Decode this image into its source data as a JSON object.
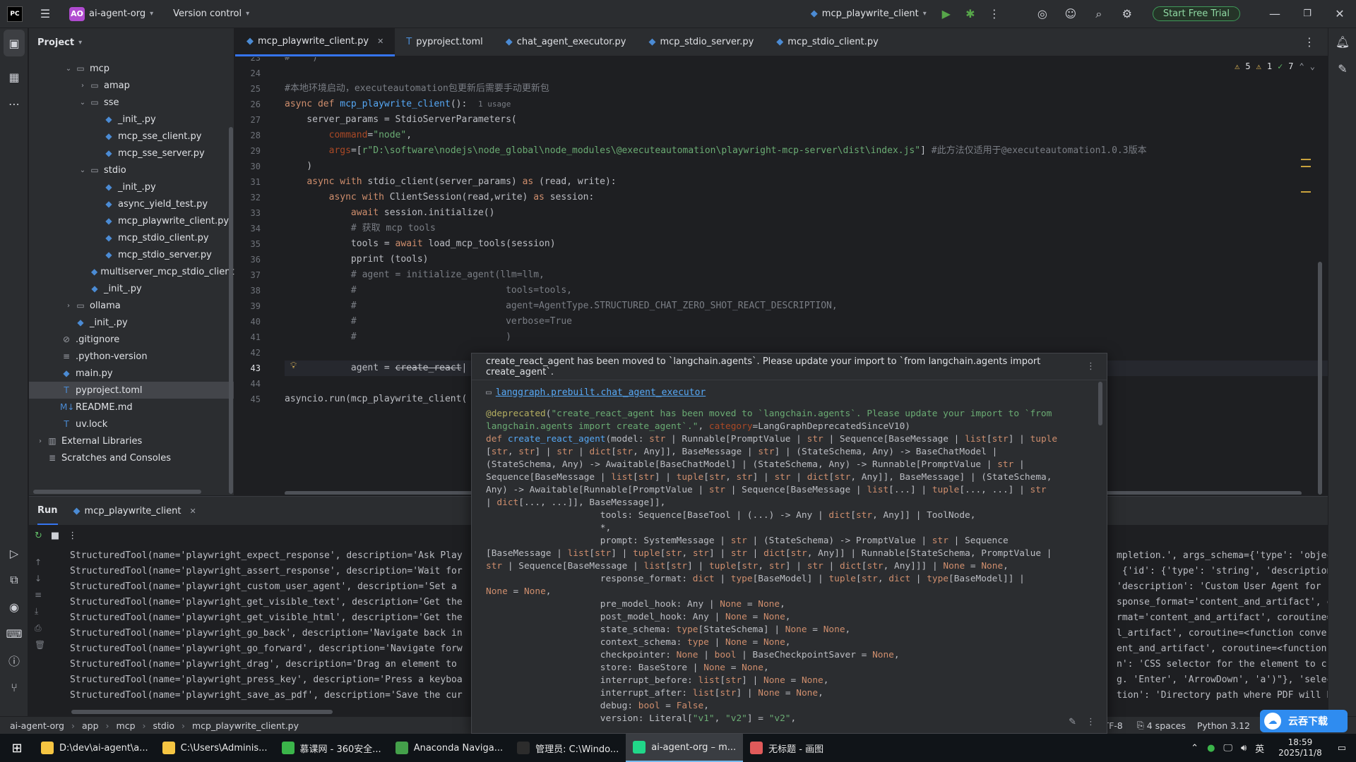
{
  "titlebar": {
    "project_badge": "AO",
    "project_name": "ai-agent-org",
    "vcs": "Version control",
    "run_config": "mcp_playwrite_client",
    "trial_button": "Start Free Trial",
    "icons": [
      "hamburger-icon",
      "run-icon",
      "debug-icon",
      "more-icon",
      "copilot-icon",
      "add-user-icon",
      "search-icon",
      "settings-icon",
      "minimize-icon",
      "restore-icon",
      "close-icon"
    ]
  },
  "project_panel": {
    "title": "Project",
    "rows": [
      {
        "label": "mcp",
        "depth": 2,
        "type": "folder",
        "open": true
      },
      {
        "label": "amap",
        "depth": 3,
        "type": "folder",
        "open": false
      },
      {
        "label": "sse",
        "depth": 3,
        "type": "folder",
        "open": true
      },
      {
        "label": "_init_.py",
        "depth": 4,
        "type": "py"
      },
      {
        "label": "mcp_sse_client.py",
        "depth": 4,
        "type": "py"
      },
      {
        "label": "mcp_sse_server.py",
        "depth": 4,
        "type": "py"
      },
      {
        "label": "stdio",
        "depth": 3,
        "type": "folder",
        "open": true
      },
      {
        "label": "_init_.py",
        "depth": 4,
        "type": "py"
      },
      {
        "label": "async_yield_test.py",
        "depth": 4,
        "type": "py"
      },
      {
        "label": "mcp_playwrite_client.py",
        "depth": 4,
        "type": "py"
      },
      {
        "label": "mcp_stdio_client.py",
        "depth": 4,
        "type": "py"
      },
      {
        "label": "mcp_stdio_server.py",
        "depth": 4,
        "type": "py"
      },
      {
        "label": "multiserver_mcp_stdio_client.",
        "depth": 4,
        "type": "py"
      },
      {
        "label": "_init_.py",
        "depth": 3,
        "type": "py"
      },
      {
        "label": "ollama",
        "depth": 2,
        "type": "folder",
        "open": false
      },
      {
        "label": "_init_.py",
        "depth": 2,
        "type": "py"
      },
      {
        "label": ".gitignore",
        "depth": 1,
        "type": "ignore"
      },
      {
        "label": ".python-version",
        "depth": 1,
        "type": "text"
      },
      {
        "label": "main.py",
        "depth": 1,
        "type": "py"
      },
      {
        "label": "pyproject.toml",
        "depth": 1,
        "type": "toml",
        "selected": true
      },
      {
        "label": "README.md",
        "depth": 1,
        "type": "md"
      },
      {
        "label": "uv.lock",
        "depth": 1,
        "type": "toml"
      },
      {
        "label": "External Libraries",
        "depth": 0,
        "type": "lib",
        "open": false
      },
      {
        "label": "Scratches and Consoles",
        "depth": 0,
        "type": "scratch"
      }
    ]
  },
  "tabs": [
    {
      "label": "mcp_playwrite_client.py",
      "active": true,
      "closable": true
    },
    {
      "label": "pyproject.toml"
    },
    {
      "label": "chat_agent_executor.py"
    },
    {
      "label": "mcp_stdio_server.py"
    },
    {
      "label": "mcp_stdio_client.py"
    }
  ],
  "inspections": {
    "warn_a": "5",
    "warn_b": "1",
    "ok": "7"
  },
  "editor": {
    "current_line": 43,
    "lines": [
      {
        "n": "23",
        "html": "<span class=\"cm\">#    )</span>"
      },
      {
        "n": "24",
        "html": ""
      },
      {
        "n": "25",
        "html": "<span class=\"cm\">#本地环境启动，executeautomation包更新后需要手动更新包</span>"
      },
      {
        "n": "26",
        "html": "<span class=\"kw\">async def </span><span class=\"fn\">mcp_playwrite_client</span>():  <span class=\"cm\" style=\"font-size:11px\">1 usage</span>"
      },
      {
        "n": "27",
        "html": "    server_params = StdioServerParameters("
      },
      {
        "n": "28",
        "html": "        <span class=\"par\">command</span>=<span class=\"str\">\"node\"</span>,"
      },
      {
        "n": "29",
        "html": "        <span class=\"par\">args</span>=[<span class=\"str\">r\"D:\\software\\nodejs\\node_global\\node_modules\\@executeautomation\\playwright-mcp-server\\dist\\index.js\"</span>] <span class=\"cm\">#此方法仅适用于@executeautomation1.0.3版本</span>"
      },
      {
        "n": "30",
        "html": "    )"
      },
      {
        "n": "31",
        "html": "    <span class=\"kw\">async with </span>stdio_client(server_params) <span class=\"kw\">as </span>(read, write):"
      },
      {
        "n": "32",
        "html": "        <span class=\"kw\">async with </span>ClientSession(read,write) <span class=\"kw\">as </span>session:"
      },
      {
        "n": "33",
        "html": "            <span class=\"kw\">await </span>session.initialize()"
      },
      {
        "n": "34",
        "html": "            <span class=\"cm\"># 获取 mcp tools</span>"
      },
      {
        "n": "35",
        "html": "            tools = <span class=\"kw\">await </span>load_mcp_tools(session)"
      },
      {
        "n": "36",
        "html": "            pprint (tools)"
      },
      {
        "n": "37",
        "html": "            <span class=\"cm\"># agent = initialize_agent(llm=llm,</span>"
      },
      {
        "n": "38",
        "html": "            <span class=\"cm\">#                           tools=tools,</span>"
      },
      {
        "n": "39",
        "html": "            <span class=\"cm\">#                           agent=AgentType.STRUCTURED_CHAT_ZERO_SHOT_REACT_DESCRIPTION,</span>"
      },
      {
        "n": "40",
        "html": "            <span class=\"cm\">#                           verbose=True</span>"
      },
      {
        "n": "41",
        "html": "            <span class=\"cm\">#                           )</span>"
      },
      {
        "n": "42",
        "html": ""
      },
      {
        "n": "43",
        "html": "            agent = <span class=\"dep\">create_react</span>|"
      },
      {
        "n": "44",
        "html": ""
      },
      {
        "n": "45",
        "html": "asyncio.run(mcp_playwrite_client("
      }
    ]
  },
  "run_panel": {
    "tab_run": "Run",
    "tab_config": "mcp_playwrite_client",
    "lines_left": [
      "StructuredTool(name='playwright_expect_response', description='Ask Play",
      "StructuredTool(name='playwright_assert_response', description='Wait for",
      "StructuredTool(name='playwright_custom_user_agent', description='Set a",
      "StructuredTool(name='playwright_get_visible_text', description='Get the",
      "StructuredTool(name='playwright_get_visible_html', description='Get the",
      "StructuredTool(name='playwright_go_back', description='Navigate back in",
      "StructuredTool(name='playwright_go_forward', description='Navigate forw",
      "StructuredTool(name='playwright_drag', description='Drag an element to",
      "StructuredTool(name='playwright_press_key', description='Press a keyboa",
      "StructuredTool(name='playwright_save_as_pdf', description='Save the cur"
    ],
    "lines_right": [
      "mpletion.', args_schema={'type': 'object",
      " {'id': {'type': 'string', 'description",
      "'description': 'Custom User Agent for",
      "sponse_format='content_and_artifact', co",
      "rmat='content_and_artifact', coroutine=",
      "l_artifact', coroutine=<function convert",
      "ent_and_artifact', coroutine=<function c",
      "n': 'CSS selector for the element to c",
      "g. 'Enter', 'ArrowDown', 'a')\"}, 'selec",
      "tion': 'Directory path where PDF will b"
    ]
  },
  "popup": {
    "message": "create_react_agent has been moved to `langchain.agents`. Please update your import to `from langchain.agents import create_agent`.",
    "module": "langgraph.prebuilt.chat_agent_executor",
    "doc_html": "<span style=\"color:#b3ae60\">@deprecated</span>(<span class=\"str\">\"create_react_agent has been moved to `langchain.agents`. Please update your import to `from\nlangchain.agents import create_agent`.\"</span>, <span class=\"par\">category</span>=LangGraphDeprecatedSinceV10)\n<span class=\"kw\">def </span><span class=\"fn\">create_react_agent</span>(model: <span class=\"kw\">str</span> | Runnable[PromptValue | <span class=\"kw\">str</span> | Sequence[BaseMessage | <span class=\"kw\">list</span>[<span class=\"kw\">str</span>] | <span class=\"kw\">tuple</span>\n[<span class=\"kw\">str</span>, <span class=\"kw\">str</span>] | <span class=\"kw\">str</span> | <span class=\"kw\">dict</span>[<span class=\"kw\">str</span>, Any]], BaseMessage | <span class=\"kw\">str</span>] | (StateSchema, Any) -&gt; BaseChatModel |\n(StateSchema, Any) -&gt; Awaitable[BaseChatModel] | (StateSchema, Any) -&gt; Runnable[PromptValue | <span class=\"kw\">str</span> |\nSequence[BaseMessage | <span class=\"kw\">list</span>[<span class=\"kw\">str</span>] | <span class=\"kw\">tuple</span>[<span class=\"kw\">str</span>, <span class=\"kw\">str</span>] | <span class=\"kw\">str</span> | <span class=\"kw\">dict</span>[<span class=\"kw\">str</span>, Any]], BaseMessage] | (StateSchema,\nAny) -&gt; Awaitable[Runnable[PromptValue | <span class=\"kw\">str</span> | Sequence[BaseMessage | <span class=\"kw\">list</span>[...] | <span class=\"kw\">tuple</span>[..., ...] | <span class=\"kw\">str</span>\n| <span class=\"kw\">dict</span>[..., ...]], BaseMessage]],\n                     tools: Sequence[BaseTool | (...) -&gt; Any | <span class=\"kw\">dict</span>[<span class=\"kw\">str</span>, Any]] | ToolNode,\n                     *,\n                     prompt: SystemMessage | <span class=\"kw\">str</span> | (StateSchema) -&gt; PromptValue | <span class=\"kw\">str</span> | Sequence\n[BaseMessage | <span class=\"kw\">list</span>[<span class=\"kw\">str</span>] | <span class=\"kw\">tuple</span>[<span class=\"kw\">str</span>, <span class=\"kw\">str</span>] | <span class=\"kw\">str</span> | <span class=\"kw\">dict</span>[<span class=\"kw\">str</span>, Any]] | Runnable[StateSchema, PromptValue |\n<span class=\"kw\">str</span> | Sequence[BaseMessage | <span class=\"kw\">list</span>[<span class=\"kw\">str</span>] | <span class=\"kw\">tuple</span>[<span class=\"kw\">str</span>, <span class=\"kw\">str</span>] | <span class=\"kw\">str</span> | <span class=\"kw\">dict</span>[<span class=\"kw\">str</span>, Any]]] | <span class=\"kw\">None</span> = <span class=\"kw\">None</span>,\n                     response_format: <span class=\"kw\">dict</span> | <span class=\"kw\">type</span>[BaseModel] | <span class=\"kw\">tuple</span>[<span class=\"kw\">str</span>, <span class=\"kw\">dict</span> | <span class=\"kw\">type</span>[BaseModel]] |\n<span class=\"kw\">None</span> = <span class=\"kw\">None</span>,\n                     pre_model_hook: Any | <span class=\"kw\">None</span> = <span class=\"kw\">None</span>,\n                     post_model_hook: Any | <span class=\"kw\">None</span> = <span class=\"kw\">None</span>,\n                     state_schema: <span class=\"kw\">type</span>[StateSchema] | <span class=\"kw\">None</span> = <span class=\"kw\">None</span>,\n                     context_schema: <span class=\"kw\">type</span> | <span class=\"kw\">None</span> = <span class=\"kw\">None</span>,\n                     checkpointer: <span class=\"kw\">None</span> | <span class=\"kw\">bool</span> | BaseCheckpointSaver = <span class=\"kw\">None</span>,\n                     store: BaseStore | <span class=\"kw\">None</span> = <span class=\"kw\">None</span>,\n                     interrupt_before: <span class=\"kw\">list</span>[<span class=\"kw\">str</span>] | <span class=\"kw\">None</span> = <span class=\"kw\">None</span>,\n                     interrupt_after: <span class=\"kw\">list</span>[<span class=\"kw\">str</span>] | <span class=\"kw\">None</span> = <span class=\"kw\">None</span>,\n                     debug: <span class=\"kw\">bool</span> = <span class=\"kw\">False</span>,\n                     version: Literal[<span class=\"str\">\"v1\"</span>, <span class=\"str\">\"v2\"</span>] = <span class=\"str\">\"v2\"</span>,"
  },
  "statusbar": {
    "breadcrumb": [
      "ai-agent-org",
      "app",
      "mcp",
      "stdio",
      "mcp_playwrite_client.py"
    ],
    "encoding": "UTF-8",
    "indent": "4 spaces",
    "interpreter": "Python 3.12"
  },
  "cloud_badge": "云吞下载",
  "taskbar": {
    "items": [
      {
        "label": "D:\\dev\\ai-agent\\a...",
        "color": "#f5c542"
      },
      {
        "label": "C:\\Users\\Adminis...",
        "color": "#f5c542"
      },
      {
        "label": "慕课网 - 360安全...",
        "color": "#3bb54a"
      },
      {
        "label": "Anaconda Naviga...",
        "color": "#44a04a"
      },
      {
        "label": "管理员: C:\\Windo...",
        "color": "#2c2c2c"
      },
      {
        "label": "ai-agent-org – m...",
        "color": "#21d789",
        "active": true
      },
      {
        "label": "无标题 - 画图",
        "color": "#e05a5a"
      }
    ],
    "ime": "英",
    "time": "18:59",
    "date": "2025/11/8"
  }
}
